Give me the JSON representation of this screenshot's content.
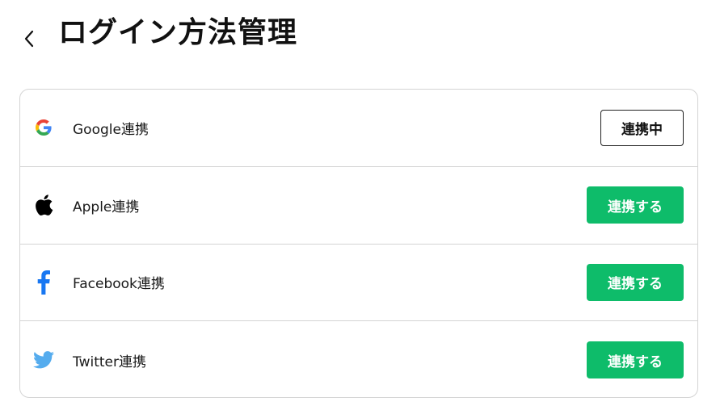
{
  "header": {
    "title": "ログイン方法管理"
  },
  "providers": [
    {
      "label": "Google連携",
      "button": "連携中",
      "status": "linked",
      "icon": "google-icon"
    },
    {
      "label": "Apple連携",
      "button": "連携する",
      "status": "unlinked",
      "icon": "apple-icon"
    },
    {
      "label": "Facebook連携",
      "button": "連携する",
      "status": "unlinked",
      "icon": "facebook-icon"
    },
    {
      "label": "Twitter連携",
      "button": "連携する",
      "status": "unlinked",
      "icon": "twitter-icon"
    }
  ],
  "colors": {
    "accent_green": "#0ebc6a",
    "facebook_blue": "#1877f2",
    "twitter_blue": "#55acee",
    "border": "#d4d4d4"
  }
}
